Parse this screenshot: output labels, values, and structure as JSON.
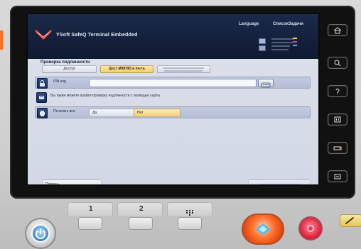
{
  "app": {
    "title": "YSoft SafeQ Terminal Embedded",
    "language_label": "Language",
    "jobs_label": "СписокЗадачи"
  },
  "auth": {
    "section_title": "Проверка подлинности",
    "tabs": [
      {
        "label": "Доступ",
        "active": false
      },
      {
        "label": "Дост МФП/ID и пч-ть",
        "active": true
      }
    ],
    "rows": {
      "pin_label": "PIN-код",
      "card_hint": "Вы также можете пройти проверку подлинности с помощью карты.",
      "print_all_label": "Печатать все",
      "yes_label": "Да",
      "no_label": "Нет"
    }
  },
  "buttons": {
    "help": "Помощь"
  },
  "hardware": {
    "keypad_labels": [
      "1",
      "2"
    ]
  },
  "colors": {
    "accent_active": "#f4cc6a",
    "screen_header": "#0f1a31",
    "start_button": "#ff6e2a",
    "stop_button": "#e0213c"
  }
}
